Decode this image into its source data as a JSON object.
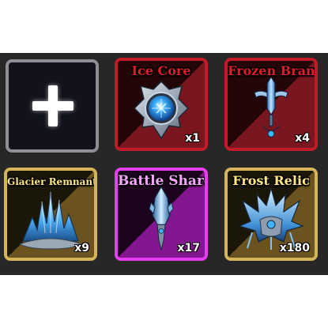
{
  "inventory": {
    "add_slot": {
      "icon": "plus-icon"
    },
    "items": [
      {
        "name": "Ice Core",
        "count": "x1",
        "rarity_color": "#c21a26",
        "icon": "ice-core-emblem-icon"
      },
      {
        "name": "Frozen Brand",
        "count": "x4",
        "rarity_color": "#c21a26",
        "icon": "frozen-brand-sword-icon"
      },
      {
        "name": "Glacier Remnant",
        "count": "x9",
        "rarity_color": "#d6b45a",
        "icon": "glacier-crystal-cluster-icon"
      },
      {
        "name": "Battle Shard",
        "count": "x17",
        "rarity_color": "#e63ef0",
        "icon": "battle-shard-icon"
      },
      {
        "name": "Frost Relic",
        "count": "x180",
        "rarity_color": "#d6b45a",
        "icon": "frost-relic-crown-icon"
      }
    ]
  }
}
